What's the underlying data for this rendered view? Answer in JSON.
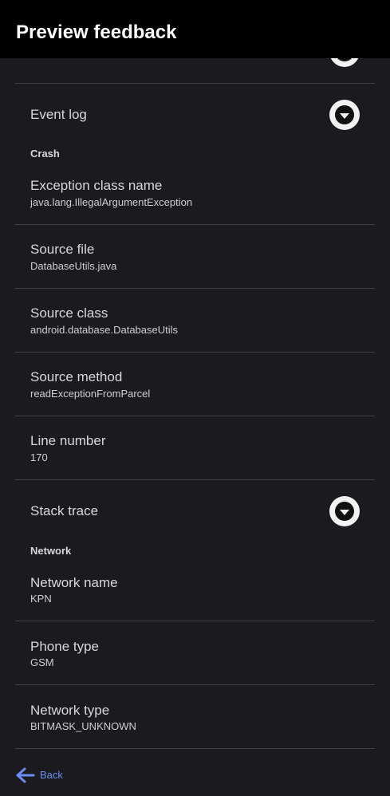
{
  "header": {
    "title": "Preview feedback"
  },
  "rows": {
    "event_log": "Event log",
    "stack_trace": "Stack trace"
  },
  "sections": {
    "crash": "Crash",
    "network": "Network"
  },
  "crash": {
    "exception_class": {
      "title": "Exception class name",
      "value": "java.lang.IllegalArgumentException"
    },
    "source_file": {
      "title": "Source file",
      "value": "DatabaseUtils.java"
    },
    "source_class": {
      "title": "Source class",
      "value": "android.database.DatabaseUtils"
    },
    "source_method": {
      "title": "Source method",
      "value": "readExceptionFromParcel"
    },
    "line_number": {
      "title": "Line number",
      "value": "170"
    }
  },
  "network": {
    "network_name": {
      "title": "Network name",
      "value": "KPN"
    },
    "phone_type": {
      "title": "Phone type",
      "value": "GSM"
    },
    "network_type": {
      "title": "Network type",
      "value": "BITMASK_UNKNOWN"
    }
  },
  "footer": {
    "back_label": "Back"
  },
  "icons": {
    "expand": "chevron-down-circle-icon",
    "back": "arrow-left-icon"
  },
  "colors": {
    "background": "#1b1b1f",
    "header": "#000000",
    "link": "#6b8ef0",
    "divider": "#3f3f44"
  }
}
